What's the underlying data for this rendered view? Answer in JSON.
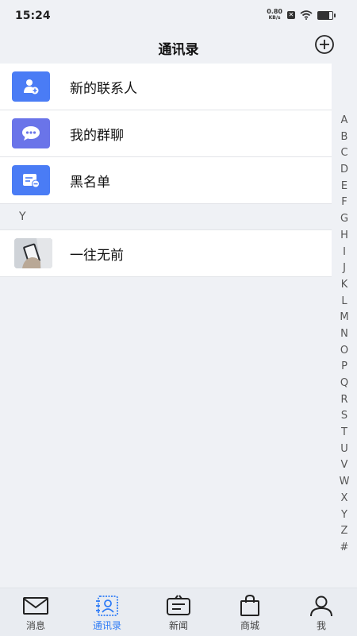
{
  "status_bar": {
    "time": "15:24",
    "net_speed_value": "0.80",
    "net_speed_unit": "KB/s",
    "sim_icon_char": "✕",
    "battery_level": 0.75
  },
  "header": {
    "title": "通讯录",
    "add_icon": "plus-circle-icon"
  },
  "colors": {
    "accent": "#2f7cf6",
    "icon_blue": "#4a7cf5",
    "icon_purple": "#6a74e9"
  },
  "function_items": [
    {
      "label": "新的联系人",
      "icon": "add-user-icon"
    },
    {
      "label": "我的群聊",
      "icon": "chat-bubble-icon"
    },
    {
      "label": "黑名单",
      "icon": "blacklist-card-icon"
    }
  ],
  "contact_sections": [
    {
      "letter": "Y",
      "contacts": [
        {
          "name": "一往无前",
          "avatar": "photo-avatar"
        }
      ]
    }
  ],
  "alphabet_index": [
    "A",
    "B",
    "C",
    "D",
    "E",
    "F",
    "G",
    "H",
    "I",
    "J",
    "K",
    "L",
    "M",
    "N",
    "O",
    "P",
    "Q",
    "R",
    "S",
    "T",
    "U",
    "V",
    "W",
    "X",
    "Y",
    "Z",
    "#"
  ],
  "tabs": [
    {
      "label": "消息",
      "icon": "envelope-icon",
      "active": false
    },
    {
      "label": "通讯录",
      "icon": "contacts-icon",
      "active": true
    },
    {
      "label": "新闻",
      "icon": "news-icon",
      "active": false
    },
    {
      "label": "商城",
      "icon": "shopping-bag-icon",
      "active": false
    },
    {
      "label": "我",
      "icon": "profile-icon",
      "active": false
    }
  ]
}
